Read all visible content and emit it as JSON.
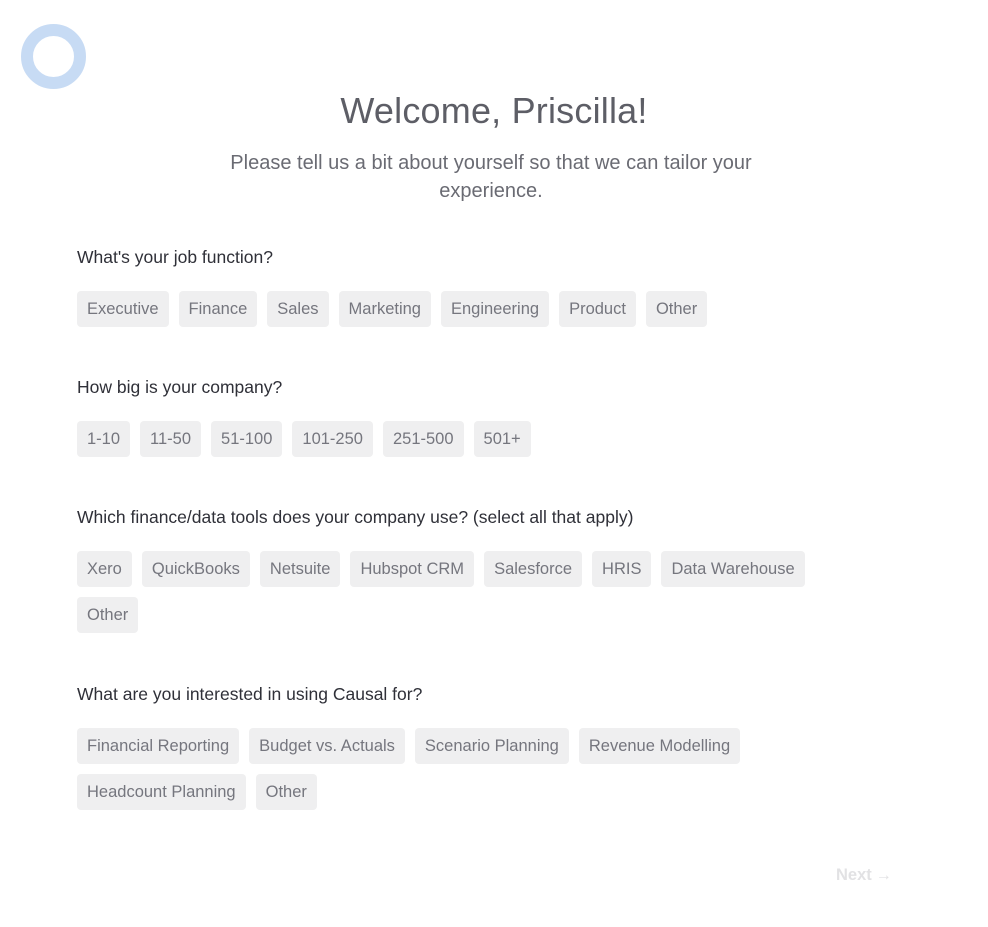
{
  "header": {
    "logo_icon": "ring-logo-icon",
    "title": "Welcome, Priscilla!",
    "subtitle": "Please tell us a bit about yourself so that we can tailor your experience."
  },
  "questions": [
    {
      "label": "What's your job function?",
      "options": [
        "Executive",
        "Finance",
        "Sales",
        "Marketing",
        "Engineering",
        "Product",
        "Other"
      ]
    },
    {
      "label": "How big is your company?",
      "options": [
        "1-10",
        "11-50",
        "51-100",
        "101-250",
        "251-500",
        "501+"
      ]
    },
    {
      "label": "Which finance/data tools does your company use? (select all that apply)",
      "options": [
        "Xero",
        "QuickBooks",
        "Netsuite",
        "Hubspot CRM",
        "Salesforce",
        "HRIS",
        "Data Warehouse",
        "Other"
      ]
    },
    {
      "label": "What are you interested in using Causal for?",
      "options": [
        "Financial Reporting",
        "Budget vs. Actuals",
        "Scenario Planning",
        "Revenue Modelling",
        "Headcount Planning",
        "Other"
      ]
    }
  ],
  "footer": {
    "next_label": "Next",
    "next_icon": "arrow-right-icon",
    "next_arrow": "→"
  },
  "colors": {
    "logo_ring": "#c7dbf4",
    "chip_bg": "#efeff0",
    "chip_text": "#75767e",
    "next_disabled": "#e2e2e4"
  }
}
